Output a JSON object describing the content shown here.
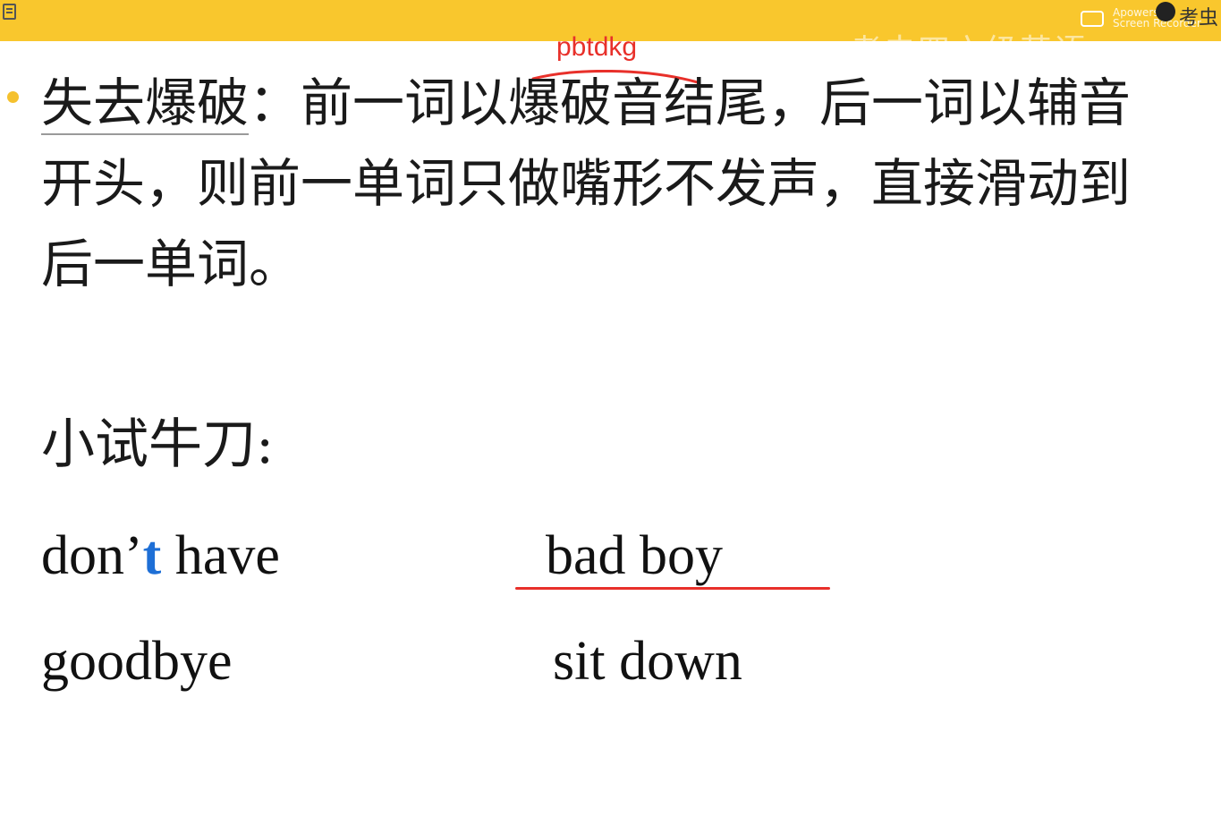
{
  "header": {
    "watermark": "考虫四六级英语",
    "logo_text_line1": "Apowersoft",
    "logo_text_line2": "Screen Recorder",
    "brand": "考虫"
  },
  "definition": {
    "term": "失去爆破",
    "colon": "：",
    "body_line1": "前一词以爆破音结尾，后一词以辅音",
    "body_line2": "开头，则前一单词只做嘴形不发声，直接滑动到",
    "body_line3": "后一单词。"
  },
  "annotation": {
    "text": "pbtdkg",
    "color": "#e8302a"
  },
  "practice": {
    "title": "小试牛刀:",
    "phrases": [
      {
        "before": "don’",
        "highlight": "t",
        "after": " have"
      },
      {
        "text": "bad boy"
      },
      {
        "text": "goodbye"
      },
      {
        "text": "sit down"
      }
    ]
  },
  "colors": {
    "top_bar": "#f9c72d",
    "bullet": "#f5c12e",
    "highlight": "#1e6fd6",
    "underline": "#e8302a"
  }
}
